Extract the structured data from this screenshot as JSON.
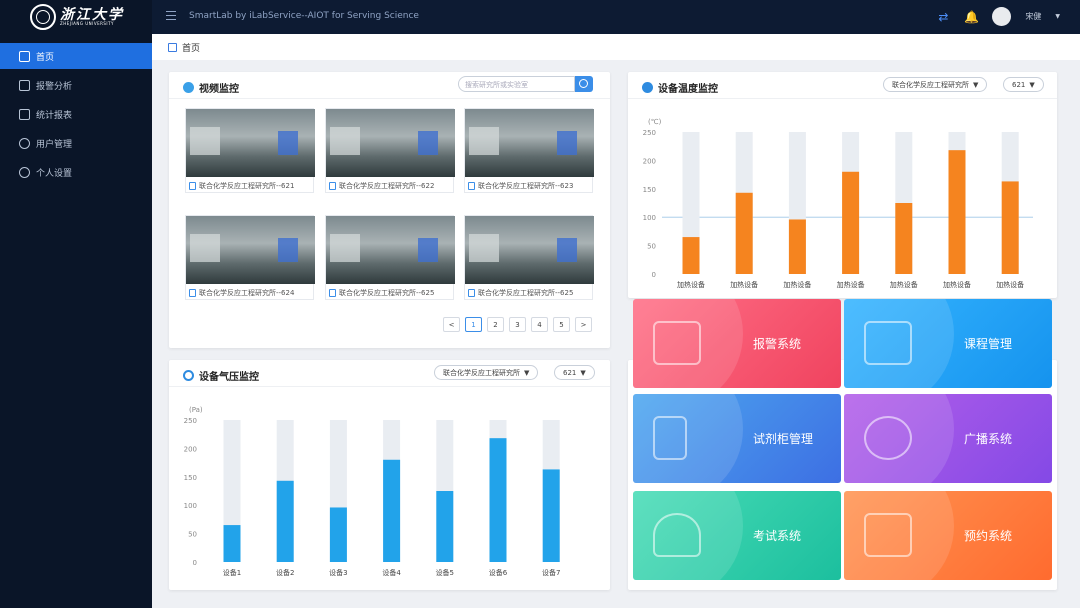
{
  "app": {
    "title": "SmartLab by iLabService--AIOT for Serving Science",
    "logo_text": "浙江大学",
    "logo_subtext": "ZHEJIANG UNIVERSITY",
    "user_name": "宋健"
  },
  "sidebar": {
    "items": [
      {
        "label": "首页",
        "icon": "home-icon",
        "active": true
      },
      {
        "label": "报警分析",
        "icon": "alarm-icon"
      },
      {
        "label": "统计报表",
        "icon": "report-icon"
      },
      {
        "label": "用户管理",
        "icon": "user-icon"
      },
      {
        "label": "个人设置",
        "icon": "gear-icon"
      }
    ]
  },
  "breadcrumb": {
    "label": "首页"
  },
  "video": {
    "title": "视频监控",
    "search_placeholder": "搜索研究所或实验室",
    "thumbnails": [
      {
        "caption": "联合化学反应工程研究所--621"
      },
      {
        "caption": "联合化学反应工程研究所--622"
      },
      {
        "caption": "联合化学反应工程研究所--623"
      },
      {
        "caption": "联合化学反应工程研究所--624"
      },
      {
        "caption": "联合化学反应工程研究所--625"
      },
      {
        "caption": "联合化学反应工程研究所--625"
      }
    ],
    "pager": {
      "prev": "<",
      "pages": [
        "1",
        "2",
        "3",
        "4",
        "5"
      ],
      "current": "1",
      "next": ">"
    }
  },
  "temp": {
    "title": "设备温度监控",
    "institute": "联合化学反应工程研究所",
    "room": "621",
    "unit": "(℃)"
  },
  "pressure": {
    "title": "设备气压监控",
    "institute": "联合化学反应工程研究所",
    "room": "621",
    "unit": "(Pa)"
  },
  "tiles": [
    {
      "label": "报警系统",
      "color": "#f2536f",
      "icon": "siren-icon"
    },
    {
      "label": "课程管理",
      "color": "#1e9bf0",
      "icon": "book-icon"
    },
    {
      "label": "试剂柜管理",
      "color": "#3d7fe6",
      "icon": "cabinet-icon"
    },
    {
      "label": "广播系统",
      "color": "#9155e8",
      "icon": "broadcast-icon"
    },
    {
      "label": "考试系统",
      "color": "#22c9a6",
      "icon": "pen-icon"
    },
    {
      "label": "预约系统",
      "color": "#ff7a3a",
      "icon": "calendar-icon"
    }
  ],
  "chart_data": [
    {
      "type": "bar",
      "title": "设备温度监控",
      "ylabel": "(℃)",
      "ylim": [
        0,
        250
      ],
      "yticks": [
        0,
        50,
        100,
        150,
        200,
        250
      ],
      "reference_line": 100,
      "categories": [
        "加热设备",
        "加热设备",
        "加热设备",
        "加热设备",
        "加热设备",
        "加热设备",
        "加热设备"
      ],
      "values": [
        65,
        143,
        96,
        180,
        125,
        218,
        163
      ],
      "max": 250,
      "bar_color": "#f5841f",
      "track_color": "#e9edf2"
    },
    {
      "type": "bar",
      "title": "设备气压监控",
      "ylabel": "(Pa)",
      "ylim": [
        0,
        250
      ],
      "yticks": [
        0,
        50,
        100,
        150,
        200,
        250
      ],
      "categories": [
        "设备1",
        "设备2",
        "设备3",
        "设备4",
        "设备5",
        "设备6",
        "设备7"
      ],
      "values": [
        65,
        143,
        96,
        180,
        125,
        218,
        163
      ],
      "max": 250,
      "bar_color": "#22a3ea",
      "track_color": "#e9edf2"
    }
  ]
}
